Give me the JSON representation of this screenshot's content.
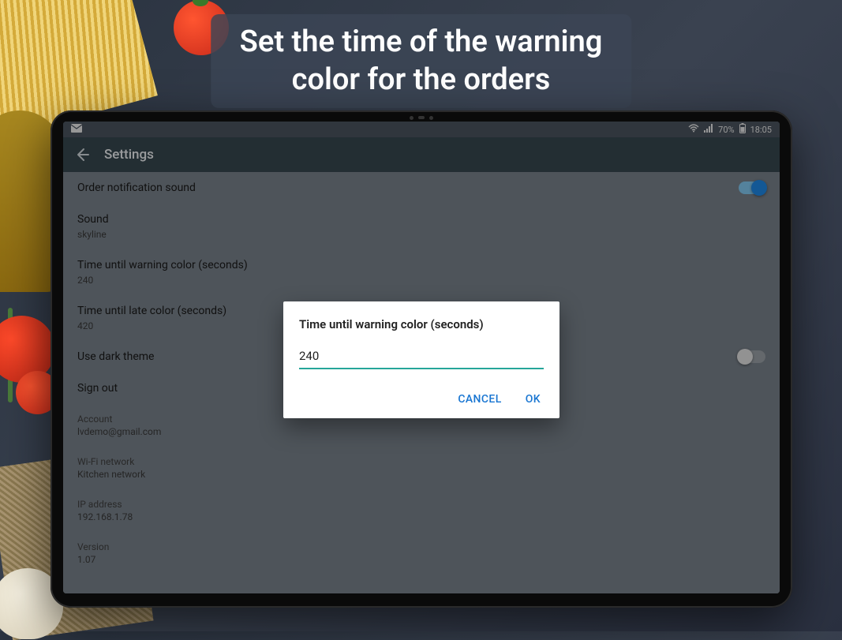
{
  "banner": "Set the time of the warning color for the orders",
  "status": {
    "battery": "70%",
    "time": "18:05"
  },
  "appbar": {
    "title": "Settings"
  },
  "rows": {
    "notif_sound": "Order notification sound",
    "sound_label": "Sound",
    "sound_value": "skyline",
    "warn_label": "Time until warning color (seconds)",
    "warn_value": "240",
    "late_label": "Time until late color (seconds)",
    "late_value": "420",
    "dark_theme": "Use dark theme",
    "sign_out": "Sign out"
  },
  "info": {
    "account_label": "Account",
    "account_value": "lvdemo@gmail.com",
    "wifi_label": "Wi-Fi network",
    "wifi_value": "Kitchen network",
    "ip_label": "IP address",
    "ip_value": "192.168.1.78",
    "version_label": "Version",
    "version_value": "1.07"
  },
  "dialog": {
    "title": "Time until warning color (seconds)",
    "value": "240",
    "cancel": "CANCEL",
    "ok": "OK"
  }
}
